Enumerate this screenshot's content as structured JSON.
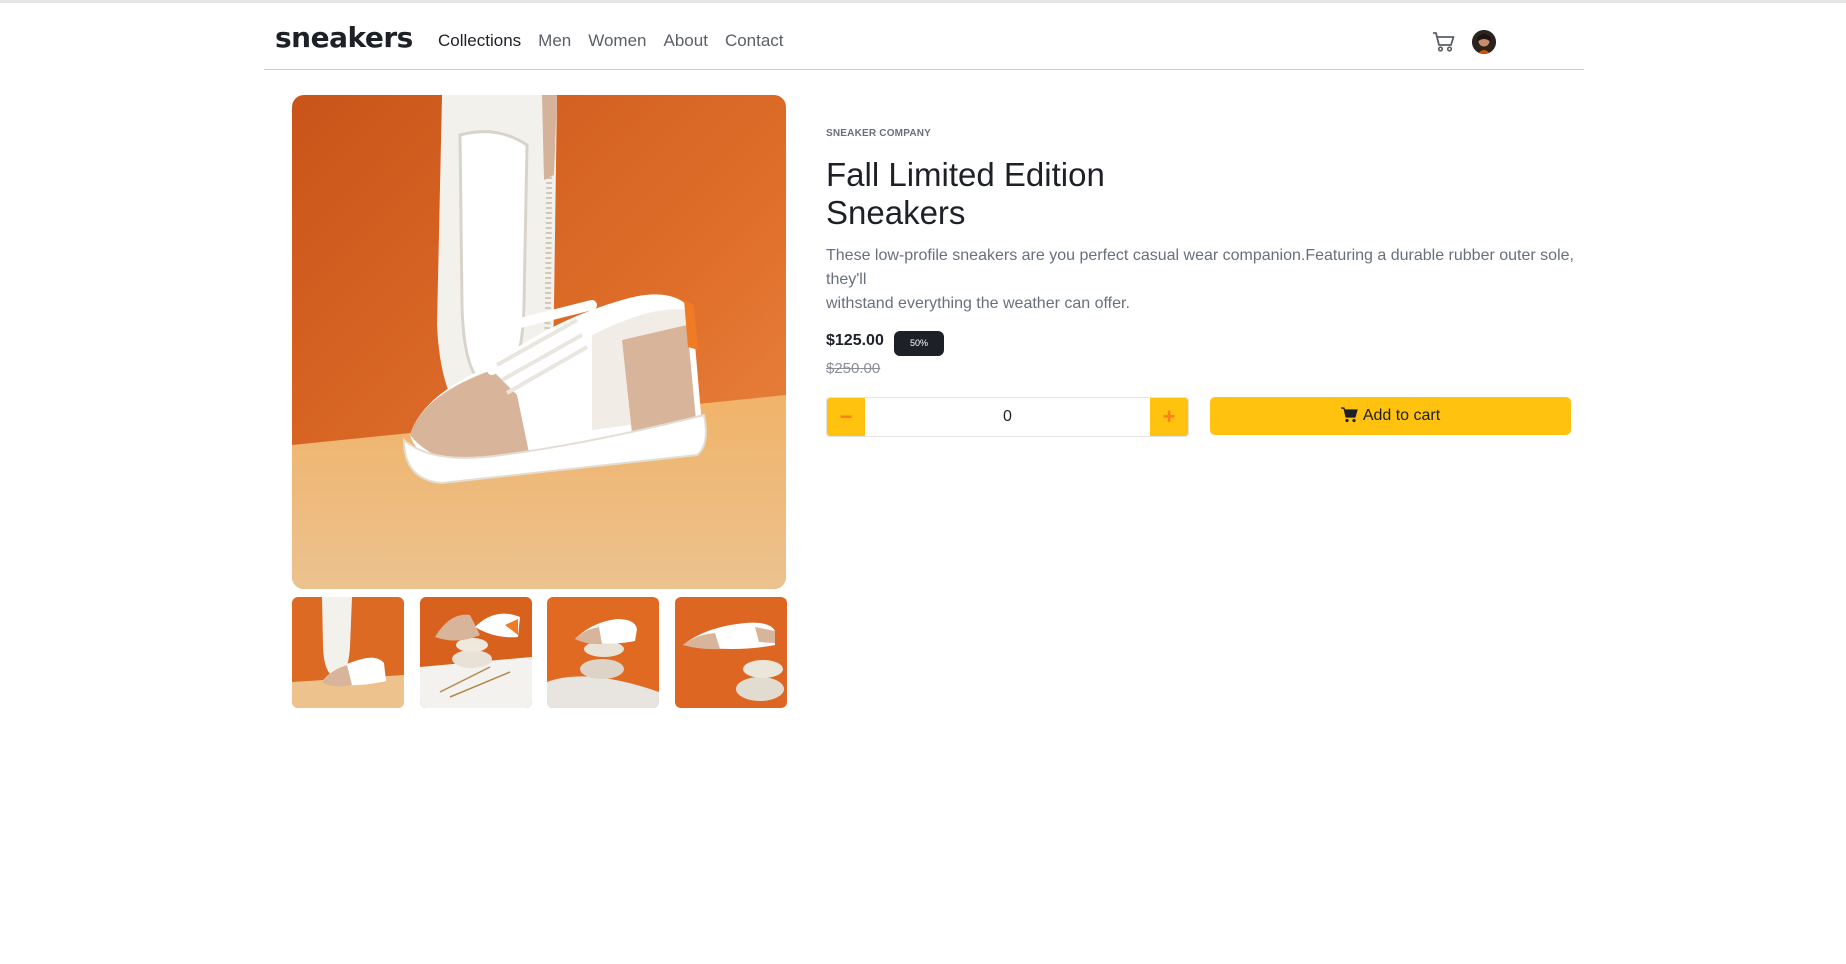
{
  "header": {
    "logo": "sneakers",
    "nav": [
      "Collections",
      "Men",
      "Women",
      "About",
      "Contact"
    ],
    "icons": {
      "cart": "cart-icon",
      "profile": "avatar"
    }
  },
  "product": {
    "company": "SNEAKER COMPANY",
    "title_line1": "Fall Limited Edition",
    "title_line2": "Sneakers",
    "description_line1": "These low-profile sneakers are you perfect casual wear companion.Featuring a durable rubber outer sole, they'll",
    "description_line2": "withstand everything the weather can offer.",
    "price": "$125.00",
    "discount": "50%",
    "old_price": "$250.00",
    "quantity": "0",
    "minus_label": "−",
    "plus_label": "+",
    "add_to_cart": "Add to cart"
  },
  "colors": {
    "accent": "#ffc20e",
    "accent_icon": "#ff7e1b",
    "text_dark": "#1d2026",
    "text_muted": "#68707d",
    "image_bg": "#e07a2e"
  }
}
